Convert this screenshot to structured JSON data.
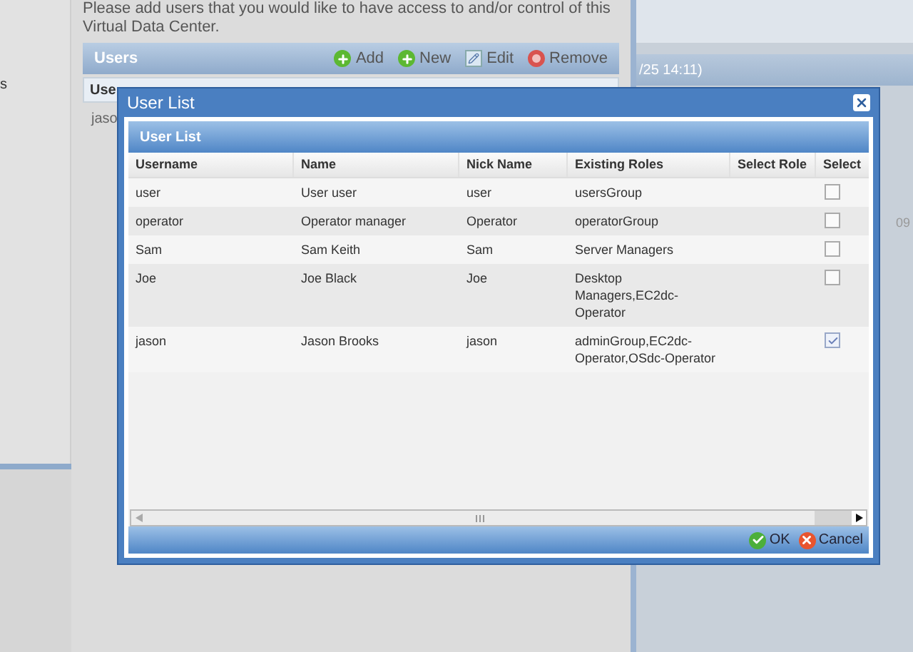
{
  "background": {
    "sidebar_text": "s",
    "intro": "Please add users that you would like to have access to and/or control of this Virtual Data Center.",
    "users_panel": {
      "title": "Users",
      "actions": [
        {
          "kind": "add",
          "label": "Add"
        },
        {
          "kind": "new",
          "label": "New"
        },
        {
          "kind": "edit",
          "label": "Edit"
        },
        {
          "kind": "remove",
          "label": "Remove"
        }
      ],
      "column_1": "Use",
      "row_1": "jaso"
    },
    "right_panel": {
      "header": "/25 14:11)",
      "cell": "09"
    }
  },
  "dialog": {
    "title": "User List",
    "panel_title": "User List",
    "columns": [
      "Username",
      "Name",
      "Nick Name",
      "Existing Roles",
      "Select Role",
      "Select"
    ],
    "rows": [
      {
        "username": "user",
        "name": "User user",
        "nick_name": "user",
        "existing_roles": "usersGroup",
        "checked": false
      },
      {
        "username": "operator",
        "name": "Operator manager",
        "nick_name": "Operator",
        "existing_roles": "operatorGroup",
        "checked": false
      },
      {
        "username": "Sam",
        "name": "Sam Keith",
        "nick_name": "Sam",
        "existing_roles": "Server Managers",
        "checked": false
      },
      {
        "username": "Joe",
        "name": "Joe Black",
        "nick_name": "Joe",
        "existing_roles": "Desktop Managers,EC2dc-Operator",
        "checked": false
      },
      {
        "username": "jason",
        "name": "Jason Brooks",
        "nick_name": "jason",
        "existing_roles": "adminGroup,EC2dc-Operator,OSdc-Operator",
        "checked": true
      }
    ],
    "buttons": [
      {
        "kind": "ok",
        "label": "OK"
      },
      {
        "kind": "cancel",
        "label": "Cancel"
      }
    ]
  }
}
